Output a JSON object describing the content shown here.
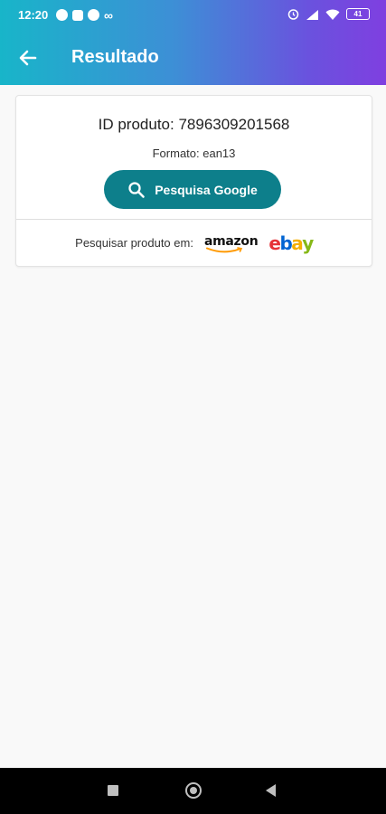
{
  "status_bar": {
    "time": "12:20",
    "battery": "41"
  },
  "app_bar": {
    "title": "Resultado"
  },
  "result": {
    "product_id_label": "ID produto: 7896309201568",
    "format_label": "Formato: ean13",
    "google_button_label": "Pesquisa Google",
    "search_in_label": "Pesquisar produto em:",
    "amazon_label": "amazon",
    "ebay_letters": [
      "e",
      "b",
      "a",
      "y"
    ]
  },
  "colors": {
    "accent": "#0d7f8b",
    "ebay_e": "#e53238",
    "ebay_b": "#0064d2",
    "ebay_a": "#f5af02",
    "ebay_y": "#86b817",
    "amazon_smile": "#ff9900"
  },
  "icons": {
    "back": "arrow-left-icon",
    "search": "search-icon",
    "nav_recent": "square-icon",
    "nav_home": "circle-icon",
    "nav_back": "triangle-icon"
  }
}
